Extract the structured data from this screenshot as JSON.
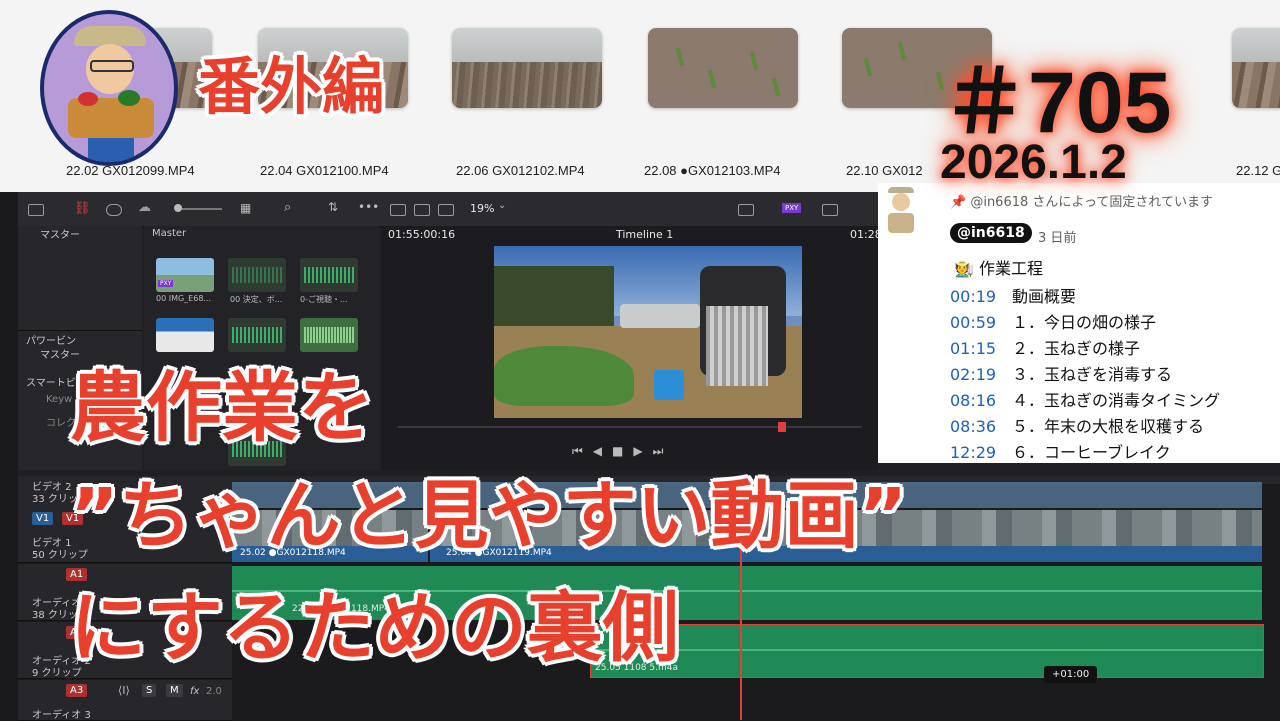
{
  "thumbnail_overlay": {
    "badge": "番外編",
    "episode": "＃705",
    "date": "2026.1.2",
    "headline_lines": [
      "農作業を",
      "”ちゃんと見やすい動画”",
      "にするための裏側"
    ]
  },
  "file_strip": {
    "files": [
      "22.02 GX012099.MP4",
      "22.04 GX012100.MP4",
      "22.06 GX012102.MP4",
      "22.08 ●GX012103.MP4",
      "22.10 GX012",
      "22.12 G"
    ]
  },
  "editor": {
    "zoom": "19%",
    "sidebar": {
      "master": "マスター",
      "power_bin": "パワービン",
      "power_bin_master": "マスター",
      "smart_bin": "スマートビン",
      "keyword": "Keyw",
      "collection": "コレク"
    },
    "media_pool": {
      "title": "Master",
      "clips": [
        "00 IMG_E68...",
        "00 決定、ボ...",
        "0-ご視聴・..."
      ],
      "proxy_badge": "PXY"
    },
    "viewer": {
      "source_timecode": "01:55:00:16",
      "timeline_name": "Timeline 1",
      "record_timecode": "01:28:"
    },
    "timeline": {
      "video_track_2_name": "ビデオ 2",
      "video_track_2_count": "33 クリップ",
      "v1_src": "V1",
      "v1_dst": "V1",
      "video_track_1_name": "ビデオ 1",
      "video_track_1_count": "50 クリップ",
      "video_clip_1": "25.02 ●GX012118.MP4",
      "video_clip_2": "25.04 ●GX012119.MP4",
      "audio1_tag": "A1",
      "audio1_name": "オーディオ 1",
      "audio1_count": "38 クリップ",
      "audio1_clip": "22.10 GX012118.MP4",
      "audio2_tag": "A2",
      "audio2_name": "オーディオ 2",
      "audio2_count": "9 クリップ",
      "audio2_clip": "25.05 1108 5.m4a",
      "audio3_tag": "A3",
      "audio3_name": "オーディオ 3",
      "audio3_level": "2.0",
      "solo": "S",
      "mute": "M",
      "fx": "fx",
      "tooltip": "+01:00"
    }
  },
  "comment": {
    "pinned_text": "@in6618 さんによって固定されています",
    "author": "@in6618",
    "age": "3 日前",
    "heading_emoji": "🧑‍🌾",
    "heading": "作業工程",
    "chapters": [
      {
        "time": "00:19",
        "title": "動画概要"
      },
      {
        "time": "00:59",
        "title": "１．今日の畑の様子"
      },
      {
        "time": "01:15",
        "title": "２．玉ねぎの様子"
      },
      {
        "time": "02:19",
        "title": "３．玉ねぎを消毒する"
      },
      {
        "time": "08:16",
        "title": "４．玉ねぎの消毒タイミング"
      },
      {
        "time": "08:36",
        "title": "５．年末の大根を収穫する"
      },
      {
        "time": "12:29",
        "title": "６．コーヒーブレイク"
      }
    ]
  },
  "colors": {
    "accent_red": "#e8402c",
    "link_blue": "#1f5fbf",
    "audio_green": "#1f8a55",
    "video_blue": "#2a5e96"
  }
}
